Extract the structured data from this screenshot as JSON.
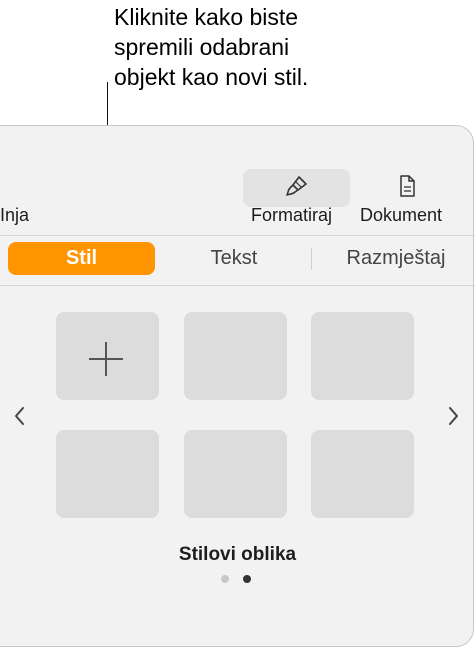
{
  "callout": {
    "lines": [
      "Kliknite kako biste",
      "spremili odabrani",
      "objekt kao novi stil."
    ]
  },
  "toolbar": {
    "left_partial_label": "Inja",
    "format_label": "Formatiraj",
    "document_label": "Dokument",
    "format_icon": "paintbrush-icon",
    "document_icon": "document-icon"
  },
  "tabs": [
    {
      "label": "Stil",
      "active": true
    },
    {
      "label": "Tekst",
      "active": false
    },
    {
      "label": "Razmještaj",
      "active": false
    }
  ],
  "style_grid": {
    "add_icon": "plus-icon",
    "prev_icon": "chevron-left-icon",
    "next_icon": "chevron-right-icon",
    "section_title": "Stilovi oblika",
    "pages": 2,
    "current_page": 2
  },
  "colors": {
    "accent": "#ff9500",
    "panel_bg": "#f2f2f2",
    "cell_bg": "#dcdcdc"
  }
}
